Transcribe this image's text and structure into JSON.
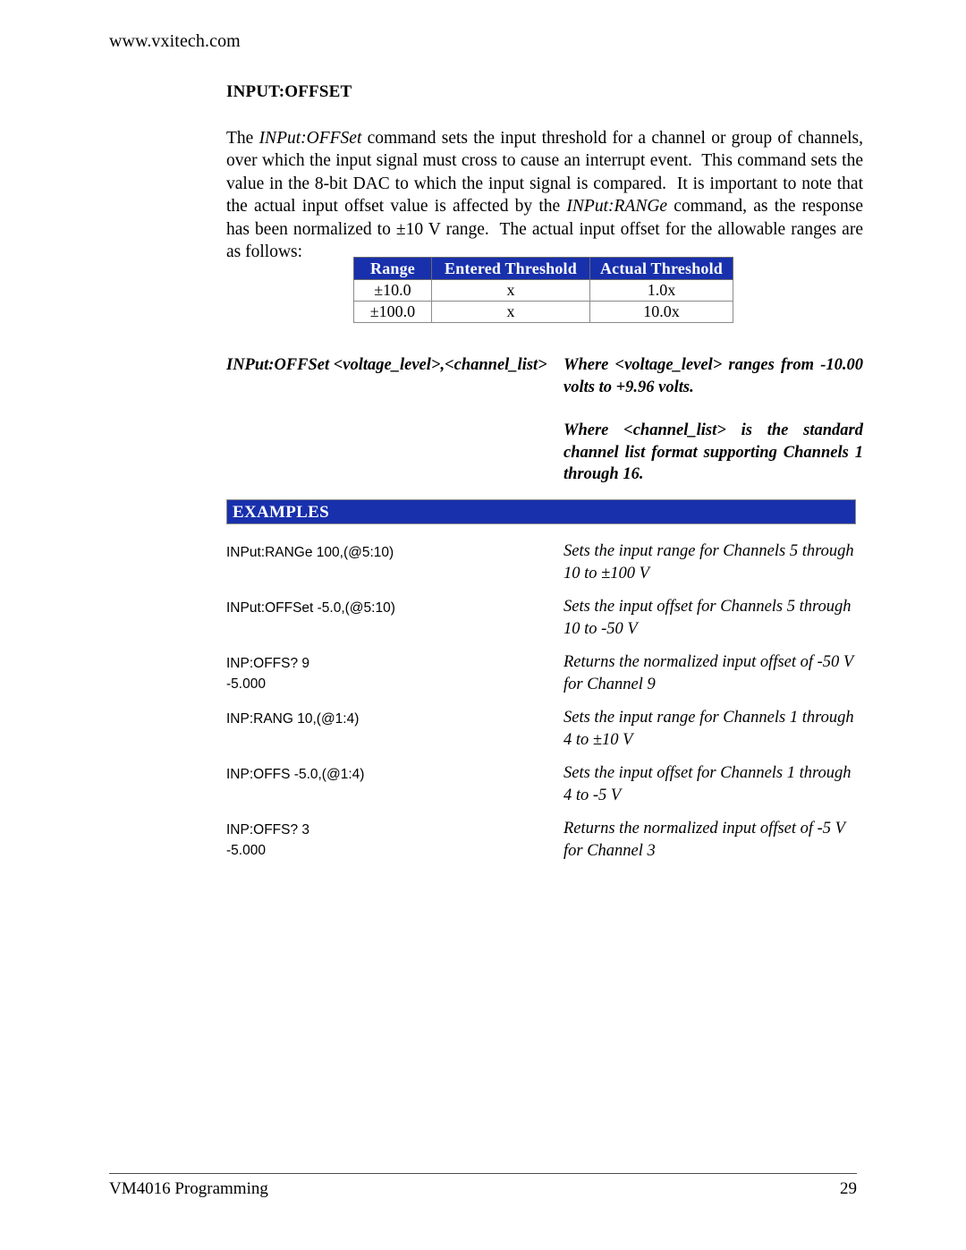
{
  "header": {
    "url": "www.vxitech.com"
  },
  "section": {
    "heading": "INPUT:OFFSET",
    "paragraph_html": "The <i>INPut:OFFSet</i> command sets the input threshold for a channel or group of channels, over which the input signal must cross to cause an interrupt event.&nbsp; This command sets the value in the 8-bit DAC to which the input signal is compared.&nbsp; It is important to note that the actual input offset value is affected by the <i>INPut:RANGe</i> command, as the response has been normalized to ±10 V range.&nbsp; The actual input offset for the allowable ranges are as follows:"
  },
  "range_table": {
    "columns": [
      "Range",
      "Entered Threshold",
      "Actual Threshold"
    ],
    "rows": [
      [
        "±10.0",
        "x",
        "1.0x"
      ],
      [
        "±100.0",
        "x",
        "10.0x"
      ]
    ]
  },
  "syntax": {
    "command": "INPut:OFFSet <voltage_level>,<channel_list>",
    "notes": [
      "Where <voltage_level> ranges from -10.00 volts to +9.96 volts.",
      "Where <channel_list> is the standard channel list format supporting Channels 1 through 16."
    ]
  },
  "examples_section": {
    "banner_label": "EXAMPLES",
    "items": [
      {
        "command": "INPut:RANGe 100,(@5:10)",
        "description": "Sets the input range for Channels 5 through 10 to ±100 V"
      },
      {
        "command": "INPut:OFFSet -5.0,(@5:10)",
        "description": "Sets the input offset for Channels 5 through 10 to -50 V"
      },
      {
        "command": "INP:OFFS? 9\n-5.000",
        "description": "Returns the normalized input offset of -50 V for Channel 9"
      },
      {
        "command": "INP:RANG 10,(@1:4)",
        "description": "Sets the input range for Channels 1 through 4 to ±10 V"
      },
      {
        "command": "INP:OFFS -5.0,(@1:4)",
        "description": "Sets the input offset for Channels 1 through 4 to -5 V"
      },
      {
        "command": "INP:OFFS? 3\n-5.000",
        "description": "Returns the normalized input offset of -5 V for Channel 3"
      }
    ]
  },
  "footer": {
    "document_title": "VM4016 Programming",
    "page_number": "29"
  },
  "colors": {
    "banner_blue": "#1830ac",
    "table_header_blue": "#1830ac",
    "text": "#000000",
    "header_text": "#ffffff"
  }
}
